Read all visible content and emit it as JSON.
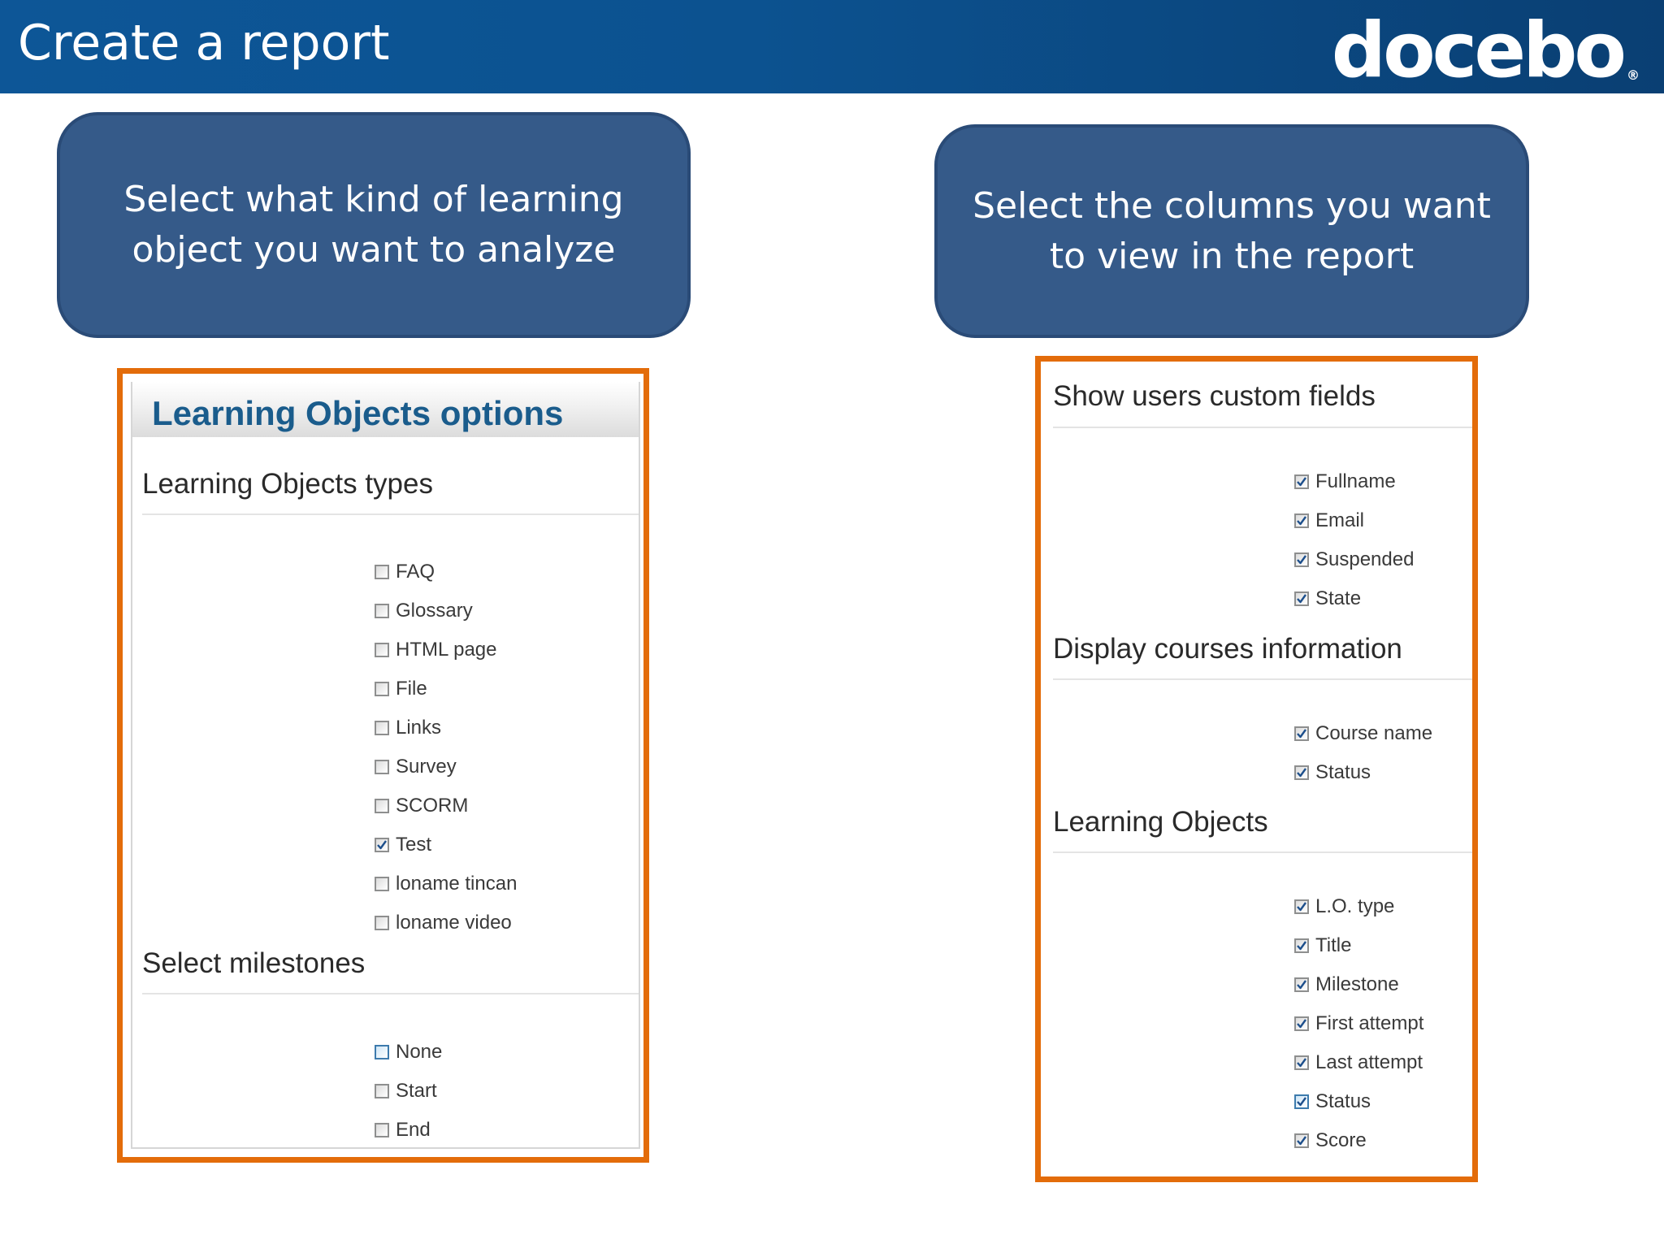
{
  "header": {
    "title": "Create a report",
    "logo_text": "docebo",
    "logo_mark": "®"
  },
  "callouts": {
    "left": "Select what kind of learning object you want to analyze",
    "right": "Select the columns you want to view in the report"
  },
  "left_panel": {
    "title": "Learning Objects options",
    "types_heading": "Learning Objects types",
    "types": [
      {
        "label": "FAQ",
        "checked": false
      },
      {
        "label": "Glossary",
        "checked": false
      },
      {
        "label": "HTML page",
        "checked": false
      },
      {
        "label": "File",
        "checked": false
      },
      {
        "label": "Links",
        "checked": false
      },
      {
        "label": "Survey",
        "checked": false
      },
      {
        "label": "SCORM",
        "checked": false
      },
      {
        "label": "Test",
        "checked": true
      },
      {
        "label": "loname tincan",
        "checked": false
      },
      {
        "label": "loname video",
        "checked": false
      }
    ],
    "milestones_heading": "Select milestones",
    "milestones": [
      {
        "label": "None",
        "checked": false,
        "highlighted": true
      },
      {
        "label": "Start",
        "checked": false
      },
      {
        "label": "End",
        "checked": false
      }
    ]
  },
  "right_panel": {
    "custom_fields_heading": "Show users custom fields",
    "custom_fields": [
      {
        "label": "Fullname",
        "checked": true
      },
      {
        "label": "Email",
        "checked": true
      },
      {
        "label": "Suspended",
        "checked": true
      },
      {
        "label": "State",
        "checked": true
      }
    ],
    "courses_heading": "Display courses information",
    "courses": [
      {
        "label": "Course name",
        "checked": true
      },
      {
        "label": "Status",
        "checked": true
      }
    ],
    "lo_heading": "Learning Objects",
    "lo_columns": [
      {
        "label": "L.O. type",
        "checked": true
      },
      {
        "label": "Title",
        "checked": true
      },
      {
        "label": "Milestone",
        "checked": true
      },
      {
        "label": "First attempt",
        "checked": true
      },
      {
        "label": "Last attempt",
        "checked": true
      },
      {
        "label": "Status",
        "checked": true,
        "highlighted": true
      },
      {
        "label": "Score",
        "checked": true
      }
    ]
  },
  "colors": {
    "header_blue": "#0c5290",
    "callout_blue": "#355a89",
    "panel_border_orange": "#e36c0a",
    "lo_title_blue": "#1a5c8c"
  },
  "icons": {
    "checkbox_checked": "checkmark-icon"
  }
}
